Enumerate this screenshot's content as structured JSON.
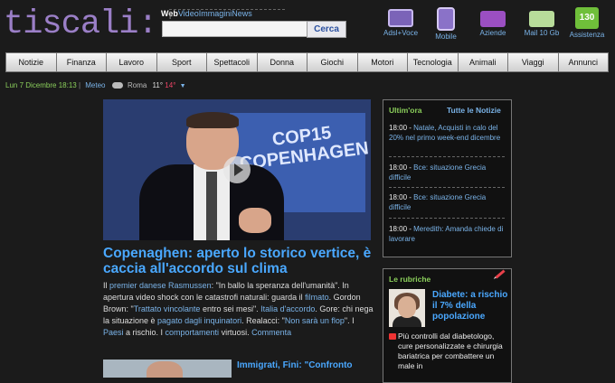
{
  "logo": "tiscali:",
  "search": {
    "tabs": [
      {
        "label": "Web",
        "selected": true
      },
      {
        "label": "Video",
        "selected": false
      },
      {
        "label": "Immagini",
        "selected": false
      },
      {
        "label": "News",
        "selected": false
      }
    ],
    "placeholder": "",
    "button": "Cerca"
  },
  "services": [
    {
      "label": "Adsl+Voce",
      "icon": "laptop-icon"
    },
    {
      "label": "Mobile",
      "icon": "mobile-phone-icon"
    },
    {
      "label": "Aziende",
      "icon": "briefcase-icon"
    },
    {
      "label": "Mail 10 Gb",
      "icon": "envelope-icon"
    },
    {
      "label": "Assistenza",
      "icon": "support-130-icon",
      "badge": "130"
    }
  ],
  "nav": [
    "Notizie",
    "Finanza",
    "Lavoro",
    "Sport",
    "Spettacoli",
    "Donna",
    "Giochi",
    "Motori",
    "Tecnologia",
    "Animali",
    "Viaggi",
    "Annunci"
  ],
  "dateline": {
    "date": "Lun 7 Dicembre 18:13",
    "sep": "|",
    "meteo": "Meteo",
    "city": "Roma",
    "tmin": "11°",
    "tmax": "14°"
  },
  "main": {
    "headline": "Copenaghen: aperto lo storico vertice, è caccia all'accordo sul clima",
    "lead": {
      "p1": "Il ",
      "l1": "premier danese Rasmussen",
      "p2": ": \"In ballo la speranza dell'umanità\". In apertura video shock con le catastrofi naturali: guarda il ",
      "l2": "filmato",
      "p3": ". Gordon Brown: \"",
      "l3": "Trattato vincolante",
      "p4": " entro sei mesi\". ",
      "l4": "Italia d'accordo",
      "p5": ". Gore: chi nega la situazione è ",
      "l5": "pagato dagli inquinatori",
      "p6": ". Realacci: \"",
      "l6": "Non sarà un flop",
      "p7": "\". I ",
      "l7": "Paesi",
      "p8": " a rischio. I ",
      "l8": "comportamenti",
      "p9": " virtuosi. ",
      "l9": "Commenta"
    },
    "image_text": "COP15 COPENHAGEN",
    "second_title": "Immigrati, Fini: \"Confronto"
  },
  "ultimora": {
    "title": "Ultim'ora",
    "all": "Tutte le Notizie",
    "items": [
      {
        "time": "18:00",
        "text": "Natale, Acquisti in calo del 20% nel primo week-end dicembre"
      },
      {
        "time": "18:00",
        "text": "Bce: situazione Grecia difficile"
      },
      {
        "time": "18:00",
        "text": "Bce: situazione Grecia difficile"
      },
      {
        "time": "18:00",
        "text": "Meredith: Amanda chiede di lavorare"
      }
    ]
  },
  "rubriche": {
    "title": "Le rubriche",
    "item_title": "Diabete: a rischio il 7% della popolazione",
    "item_text": "Più controlli dal diabetologo, cure personalizzate e chirurgia bariatrica per combattere un male in"
  }
}
